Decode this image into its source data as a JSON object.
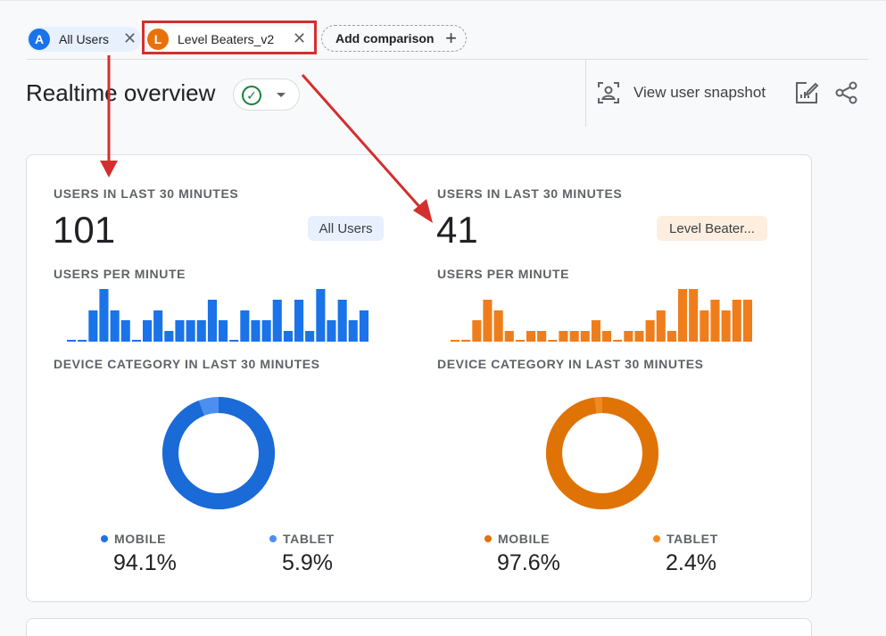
{
  "comparisons": {
    "chips": [
      {
        "avatar": "A",
        "label": "All Users",
        "color": "#1a73e8"
      },
      {
        "avatar": "L",
        "label": "Level Beaters_v2",
        "color": "#e8710a"
      }
    ],
    "add_label": "Add comparison"
  },
  "header": {
    "title": "Realtime overview",
    "snapshot_label": "View user snapshot"
  },
  "segments": [
    {
      "key": "a",
      "users_label": "USERS IN LAST 30 MINUTES",
      "users_value": "101",
      "badge": "All Users",
      "per_minute_label": "USERS PER MINUTE",
      "device_label": "DEVICE CATEGORY IN LAST 30 MINUTES",
      "bar_color": "#1a73e8",
      "donut_main_color": "#1a6ad8",
      "donut_minor_color": "#4d8ff0",
      "legend": [
        {
          "label": "MOBILE",
          "value": "94.1%",
          "color": "#1a73e8"
        },
        {
          "label": "TABLET",
          "value": "5.9%",
          "color": "#4d8ff0"
        }
      ],
      "mobile_share": 0.941
    },
    {
      "key": "l",
      "users_label": "USERS IN LAST 30 MINUTES",
      "users_value": "41",
      "badge": "Level Beater...",
      "per_minute_label": "USERS PER MINUTE",
      "device_label": "DEVICE CATEGORY IN LAST 30 MINUTES",
      "bar_color": "#f07d1b",
      "donut_main_color": "#e07306",
      "donut_minor_color": "#f28a22",
      "legend": [
        {
          "label": "MOBILE",
          "value": "97.6%",
          "color": "#e07306"
        },
        {
          "label": "TABLET",
          "value": "2.4%",
          "color": "#f28a22"
        }
      ],
      "mobile_share": 0.976
    }
  ],
  "chart_data": [
    {
      "type": "bar",
      "series": [
        {
          "values": [
            0,
            0,
            3,
            5,
            3,
            2,
            0,
            2,
            3,
            1,
            2,
            2,
            2,
            4,
            2,
            0,
            3,
            2,
            2,
            4,
            1,
            4,
            1,
            5,
            2,
            4,
            2,
            3
          ]
        }
      ],
      "ylim": [
        0,
        5
      ]
    },
    {
      "type": "bar",
      "series": [
        {
          "values": [
            0,
            0,
            2,
            4,
            3,
            1,
            0,
            1,
            1,
            0,
            1,
            1,
            1,
            2,
            1,
            0,
            1,
            1,
            2,
            3,
            1,
            5,
            5,
            3,
            4,
            3,
            4,
            4
          ]
        }
      ],
      "ylim": [
        0,
        5
      ]
    }
  ]
}
